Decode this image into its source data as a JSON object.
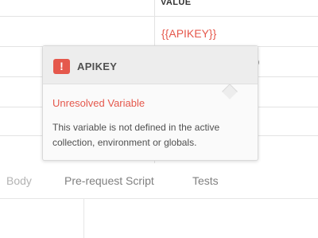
{
  "params_table": {
    "value_header": "VALUE",
    "value_cell": "{{APIKEY}}",
    "partial_char": ")"
  },
  "tooltip": {
    "icon_glyph": "!",
    "icon": "alert-icon",
    "title": "APIKEY",
    "subtitle": "Unresolved Variable",
    "description": "This variable is not defined in the active collection, environment or globals."
  },
  "tabs": [
    {
      "label": "Body"
    },
    {
      "label": "Pre-request Script"
    },
    {
      "label": "Tests"
    }
  ],
  "colors": {
    "error": "#e5584c",
    "muted_text": "#808080",
    "border": "#e3e3e3"
  }
}
